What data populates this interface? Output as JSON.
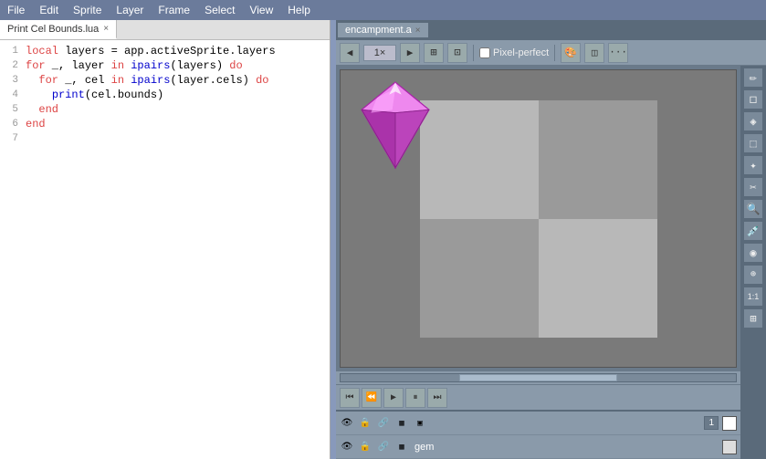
{
  "menubar": {
    "items": [
      "File",
      "Edit",
      "Sprite",
      "Layer",
      "Frame",
      "Select",
      "View",
      "Help"
    ]
  },
  "code_editor": {
    "tab_label": "Print Cel Bounds.lua",
    "tab_close": "×",
    "lines": [
      {
        "num": "1",
        "tokens": [
          {
            "t": "local",
            "c": "kw"
          },
          {
            "t": " layers = ",
            "c": "plain"
          },
          {
            "t": "app",
            "c": "plain"
          },
          {
            "t": ".activeSprite.",
            "c": "plain"
          },
          {
            "t": "layers",
            "c": "plain"
          }
        ]
      },
      {
        "num": "2",
        "tokens": [
          {
            "t": "for",
            "c": "kw"
          },
          {
            "t": " _, layer ",
            "c": "plain"
          },
          {
            "t": "in",
            "c": "kw"
          },
          {
            "t": " ",
            "c": "plain"
          },
          {
            "t": "ipairs",
            "c": "fn"
          },
          {
            "t": "(layers) ",
            "c": "plain"
          },
          {
            "t": "do",
            "c": "kw"
          }
        ]
      },
      {
        "num": "3",
        "tokens": [
          {
            "t": "  for",
            "c": "kw"
          },
          {
            "t": " _, cel ",
            "c": "plain"
          },
          {
            "t": "in",
            "c": "kw"
          },
          {
            "t": " ",
            "c": "plain"
          },
          {
            "t": "ipairs",
            "c": "fn"
          },
          {
            "t": "(layer.cels) ",
            "c": "plain"
          },
          {
            "t": "do",
            "c": "kw"
          }
        ]
      },
      {
        "num": "4",
        "tokens": [
          {
            "t": "    ",
            "c": "plain"
          },
          {
            "t": "print",
            "c": "fn"
          },
          {
            "t": "(cel.bounds)",
            "c": "plain"
          }
        ]
      },
      {
        "num": "5",
        "tokens": [
          {
            "t": "  ",
            "c": "plain"
          },
          {
            "t": "end",
            "c": "kw"
          }
        ]
      },
      {
        "num": "6",
        "tokens": [
          {
            "t": "end",
            "c": "kw"
          }
        ]
      },
      {
        "num": "7",
        "tokens": []
      }
    ]
  },
  "sprite_editor": {
    "tab_label": "encampment.a",
    "tab_close": "×",
    "zoom": "1×",
    "pixel_perfect_label": "Pixel-perfect",
    "canvas_bg": "#7a7a7a",
    "layers": [
      {
        "visible_icon": "👁",
        "lock_icon": "🔒",
        "link_icon": "🔗",
        "expand_icon": "▸",
        "frame_count": "1",
        "swatch_color": "#ffffff",
        "name": ""
      },
      {
        "visible_icon": "👁",
        "lock_icon": "🔒",
        "link_icon": "🔗",
        "expand_icon": "",
        "frame_count": "",
        "swatch_color": "#dddddd",
        "name": "gem"
      }
    ],
    "anim_buttons": [
      "⏮",
      "⏪",
      "▶",
      "⏸",
      "⏭"
    ],
    "tools": [
      "✏️",
      "◻",
      "◯",
      "⟶",
      "⌖",
      "✂",
      "🔍",
      "✦",
      "◉",
      "🔎",
      "1:1",
      "⊞"
    ]
  }
}
